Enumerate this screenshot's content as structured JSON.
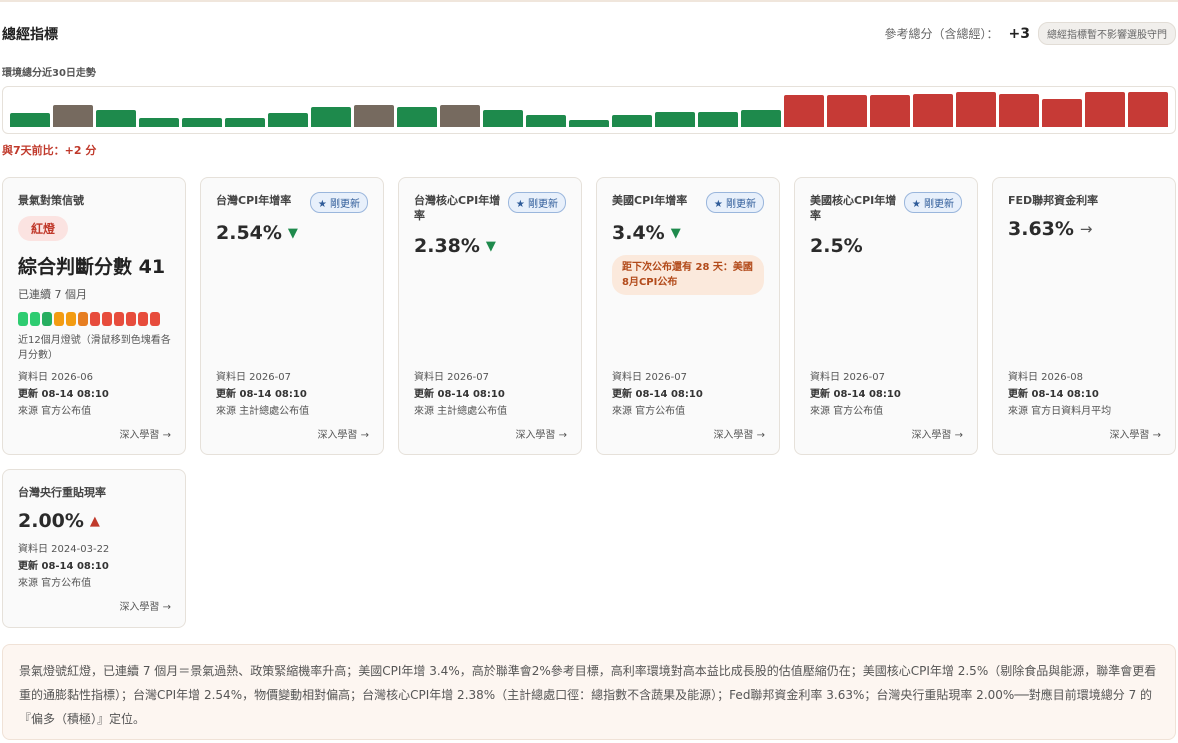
{
  "header": {
    "title": "總經指標",
    "score_label": "參考總分（含總經）：",
    "score_value": "+3",
    "hint": "總經指標暫不影響選股守門"
  },
  "trend": {
    "label": "環境總分近30日走勢",
    "compare": "與7天前比：+2 分",
    "colors": {
      "green": "#1e8a4c",
      "gray": "#766a5f",
      "red": "#c63a36"
    },
    "bars": [
      {
        "v": 0.38,
        "c": "green"
      },
      {
        "v": 0.62,
        "c": "gray"
      },
      {
        "v": 0.48,
        "c": "green"
      },
      {
        "v": 0.26,
        "c": "green"
      },
      {
        "v": 0.26,
        "c": "green"
      },
      {
        "v": 0.26,
        "c": "green"
      },
      {
        "v": 0.38,
        "c": "green"
      },
      {
        "v": 0.55,
        "c": "green"
      },
      {
        "v": 0.62,
        "c": "gray"
      },
      {
        "v": 0.55,
        "c": "green"
      },
      {
        "v": 0.62,
        "c": "gray"
      },
      {
        "v": 0.48,
        "c": "green"
      },
      {
        "v": 0.32,
        "c": "green"
      },
      {
        "v": 0.2,
        "c": "green"
      },
      {
        "v": 0.32,
        "c": "green"
      },
      {
        "v": 0.42,
        "c": "green"
      },
      {
        "v": 0.42,
        "c": "green"
      },
      {
        "v": 0.48,
        "c": "green"
      },
      {
        "v": 0.9,
        "c": "red"
      },
      {
        "v": 0.9,
        "c": "red"
      },
      {
        "v": 0.9,
        "c": "red"
      },
      {
        "v": 0.92,
        "c": "red"
      },
      {
        "v": 0.97,
        "c": "red"
      },
      {
        "v": 0.92,
        "c": "red"
      },
      {
        "v": 0.78,
        "c": "red"
      },
      {
        "v": 0.97,
        "c": "red"
      },
      {
        "v": 0.97,
        "c": "red"
      }
    ]
  },
  "signal_card": {
    "title": "景氣對策信號",
    "light": "紅燈",
    "score": "綜合判斷分數 41",
    "months": "已連續 7 個月",
    "dots": [
      "#2ecc71",
      "#2ecc71",
      "#27ae60",
      "#f39c12",
      "#f39c12",
      "#e67e22",
      "#e74c3c",
      "#e74c3c",
      "#e74c3c",
      "#e74c3c",
      "#e74c3c",
      "#e74c3c"
    ],
    "dots_note": "近12個月燈號（滑鼠移到色塊看各月分數）",
    "date": "資料日 2026-06",
    "updated": "更新 08-14 08:10",
    "source": "來源 官方公布值",
    "learn": "深入學習 →"
  },
  "cards": [
    {
      "title": "台灣CPI年增率",
      "badge": "★ 剛更新",
      "value": "2.54%",
      "arrow": "▼",
      "date": "資料日 2026-07",
      "updated": "更新 08-14 08:10",
      "source": "來源 主計總處公布值",
      "learn": "深入學習 →"
    },
    {
      "title": "台灣核心CPI年增率",
      "badge": "★ 剛更新",
      "value": "2.38%",
      "arrow": "▼",
      "date": "資料日 2026-07",
      "updated": "更新 08-14 08:10",
      "source": "來源 主計總處公布值",
      "learn": "深入學習 →"
    },
    {
      "title": "美國CPI年增率",
      "badge": "★ 剛更新",
      "value": "3.4%",
      "arrow": "▼",
      "notice": "距下次公布還有 28 天：美國8月CPI公布",
      "date": "資料日 2026-07",
      "updated": "更新 08-14 08:10",
      "source": "來源 官方公布值",
      "learn": "深入學習 →"
    },
    {
      "title": "美國核心CPI年增率",
      "badge": "★ 剛更新",
      "value": "2.5%",
      "arrow": "",
      "date": "資料日 2026-07",
      "updated": "更新 08-14 08:10",
      "source": "來源 官方公布值",
      "learn": "深入學習 →"
    },
    {
      "title": "FED聯邦資金利率",
      "badge": "",
      "value": "3.63%",
      "arrow": "→",
      "date": "資料日 2026-08",
      "updated": "更新 08-14 08:10",
      "source": "來源 官方日資料月平均",
      "learn": "深入學習 →"
    },
    {
      "title": "台灣央行重貼現率",
      "badge": "",
      "value": "2.00%",
      "arrow": "▲",
      "date": "資料日 2024-03-22",
      "updated": "更新 08-14 08:10",
      "source": "來源 官方公布值",
      "learn": "深入學習 →"
    }
  ],
  "summary": "景氣燈號紅燈，已連續 7 個月＝景氣過熱、政策緊縮機率升高；美國CPI年增 3.4%，高於聯準會2%參考目標，高利率環境對高本益比成長股的估值壓縮仍在；美國核心CPI年增 2.5%（剔除食品與能源，聯準會更看重的通膨黏性指標）；台灣CPI年增 2.54%，物價變動相對偏高；台灣核心CPI年增 2.38%（主計總處口徑：總指數不含蔬果及能源）；Fed聯邦資金利率 3.63%；台灣央行重貼現率 2.00%──對應目前環境總分 7 的『偏多（積極）』定位。"
}
